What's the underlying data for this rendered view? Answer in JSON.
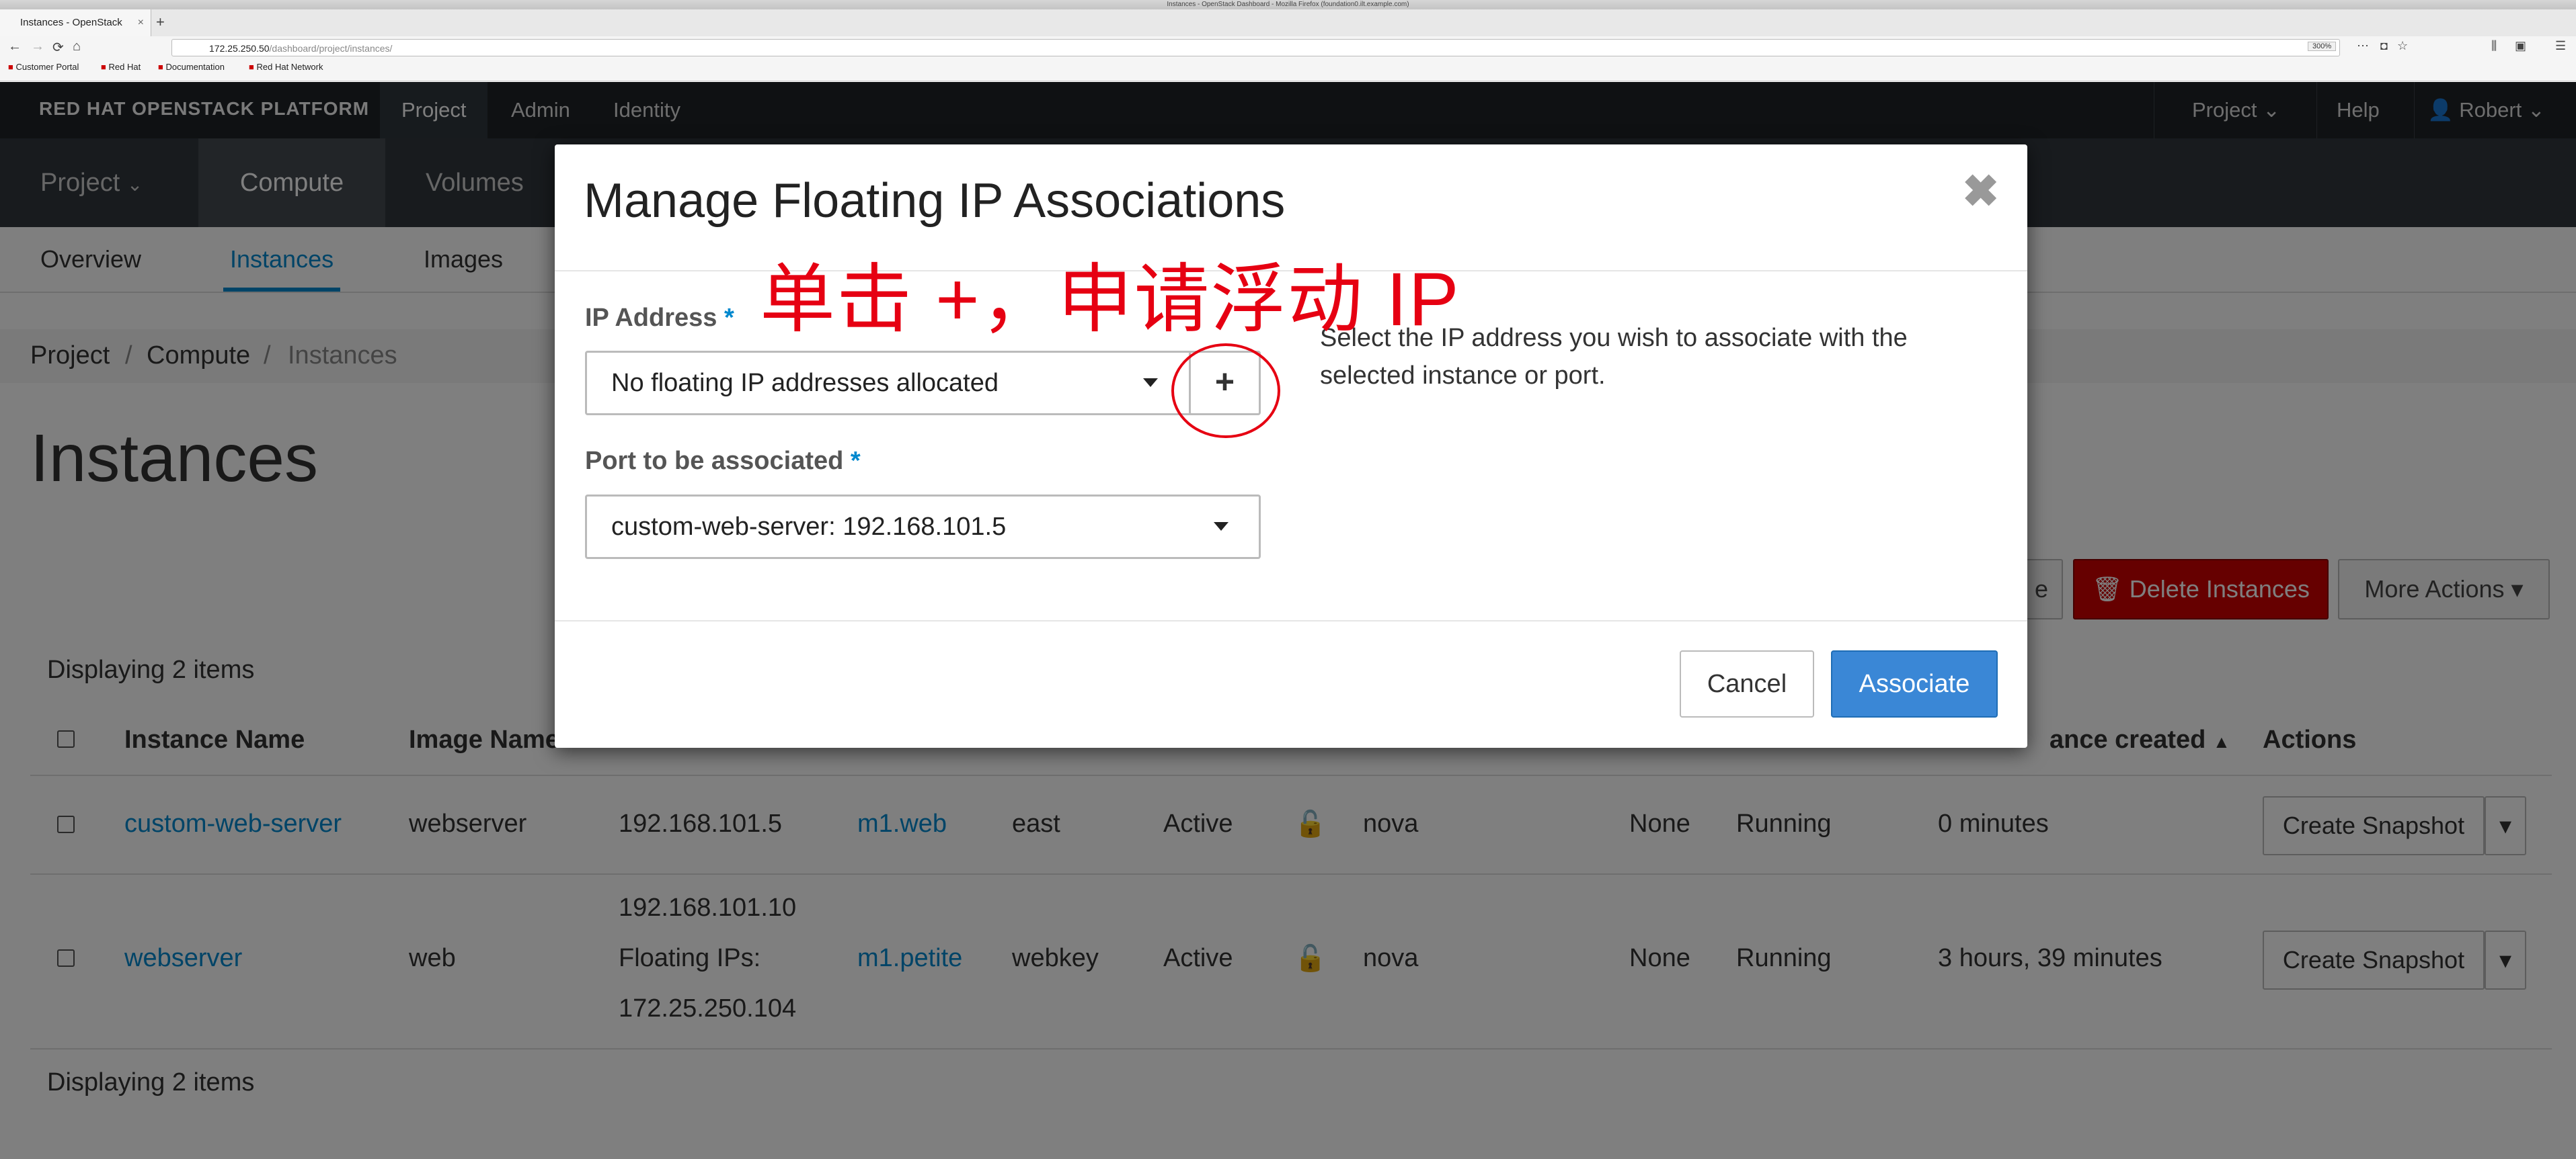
{
  "browser": {
    "window_title": "Instances - OpenStack Dashboard - Mozilla Firefox (foundation0.ilt.example.com)",
    "tab_title": "Instances - OpenStack",
    "url_host": "172.25.250.50",
    "url_path": "/dashboard/project/instances/",
    "zoom": "300%",
    "bookmarks": [
      "Customer Portal",
      "Red Hat",
      "Documentation",
      "Red Hat Network"
    ]
  },
  "brand": "RED HAT OPENSTACK PLATFORM",
  "top_nav": {
    "items": [
      "Project",
      "Admin",
      "Identity"
    ],
    "right": [
      "Project",
      "Help",
      "Robert"
    ]
  },
  "sec_nav": {
    "items": [
      "Project",
      "Compute",
      "Volumes"
    ]
  },
  "tab_nav": {
    "items": [
      "Overview",
      "Instances",
      "Images"
    ]
  },
  "breadcrumb": [
    "Project",
    "Compute",
    "Instances"
  ],
  "page_title": "Instances",
  "toolbar": {
    "partial_button": "e",
    "delete_instances": "Delete Instances",
    "more_actions": "More Actions"
  },
  "displaying": "Displaying 2 items",
  "table": {
    "headers": [
      "Instance Name",
      "Image Name",
      "ance created",
      "Actions"
    ],
    "rows": [
      {
        "name": "custom-web-server",
        "image": "webserver",
        "ip1": "192.168.101.5",
        "ip2": "",
        "ip3": "",
        "flavor": "m1.web",
        "key": "east",
        "status": "Active",
        "zone": "nova",
        "task": "None",
        "power": "Running",
        "age": "0 minutes",
        "action": "Create Snapshot"
      },
      {
        "name": "webserver",
        "image": "web",
        "ip1": "192.168.101.10",
        "ip2": "Floating IPs:",
        "ip3": "172.25.250.104",
        "flavor": "m1.petite",
        "key": "webkey",
        "status": "Active",
        "zone": "nova",
        "task": "None",
        "power": "Running",
        "age": "3 hours, 39 minutes",
        "action": "Create Snapshot"
      }
    ]
  },
  "modal": {
    "title": "Manage Floating IP Associations",
    "ip_label": "IP Address",
    "ip_value": "No floating IP addresses allocated",
    "port_label": "Port to be associated",
    "port_value": "custom-web-server: 192.168.101.5",
    "required_mark": "*",
    "help": "Select the IP address you wish to associate with the selected instance or port.",
    "cancel": "Cancel",
    "associate": "Associate"
  },
  "annotation": "单击 +，申请浮动 IP",
  "colors": {
    "accent": "#0088ce",
    "annotation": "#e60012",
    "danger": "#cc0000"
  }
}
